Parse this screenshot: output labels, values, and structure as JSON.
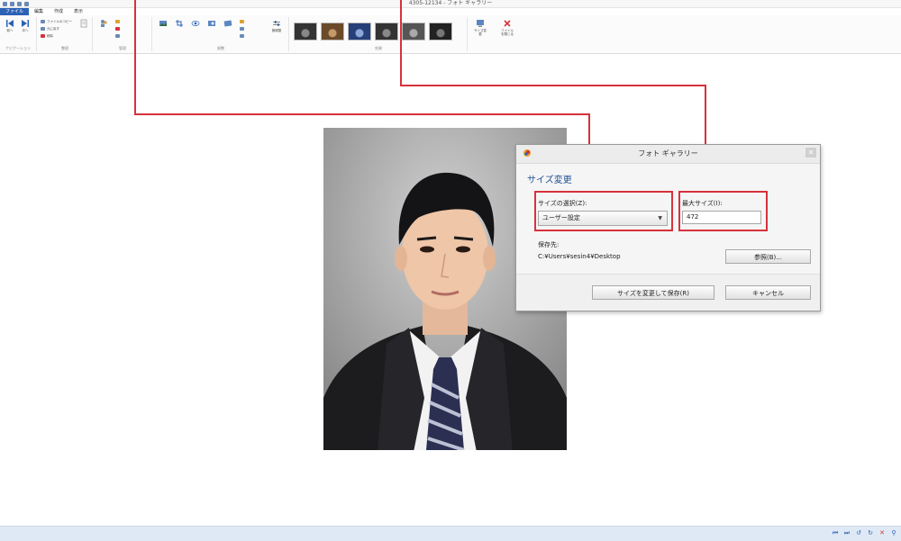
{
  "window": {
    "title": "4305-12134 - フォト ギャラリー"
  },
  "tabs": [
    {
      "label": "ファイル"
    },
    {
      "label": "編集"
    },
    {
      "label": "作成"
    },
    {
      "label": "表示"
    }
  ],
  "ribbon": {
    "groups": [
      {
        "label": "ナビゲーション"
      },
      {
        "label": "整理"
      },
      {
        "label": "管理"
      },
      {
        "label": "調整"
      },
      {
        "label": "効果"
      },
      {
        "label": ""
      }
    ],
    "buttons": {
      "prev": "前へ",
      "next": "次へ",
      "copy": "ファイルのコピー",
      "revert": "元に戻す",
      "delete": "削除",
      "auto_adjust": "自動調整",
      "crop": "トリミング",
      "redeye": "赤目",
      "retouch": "修整",
      "straighten": "傾き補正",
      "size_change": "サイズ変更",
      "close": "ファイルを閉じる",
      "adjust": "微調整"
    }
  },
  "dialog": {
    "title": "フォト ギャラリー",
    "heading": "サイズ変更",
    "size_label": "サイズの選択(Z):",
    "size_value": "ユーザー設定",
    "max_label": "最大サイズ(I):",
    "max_value": "472",
    "dest_label": "保存先:",
    "dest_path": "C:¥Users¥sesin4¥Desktop",
    "browse": "参照(B)...",
    "save": "サイズを変更して保存(R)",
    "cancel": "キャンセル"
  },
  "colors": {
    "accent": "#2b62b5",
    "annotation_red": "#d6323c",
    "heading_blue": "#1f4e96"
  }
}
